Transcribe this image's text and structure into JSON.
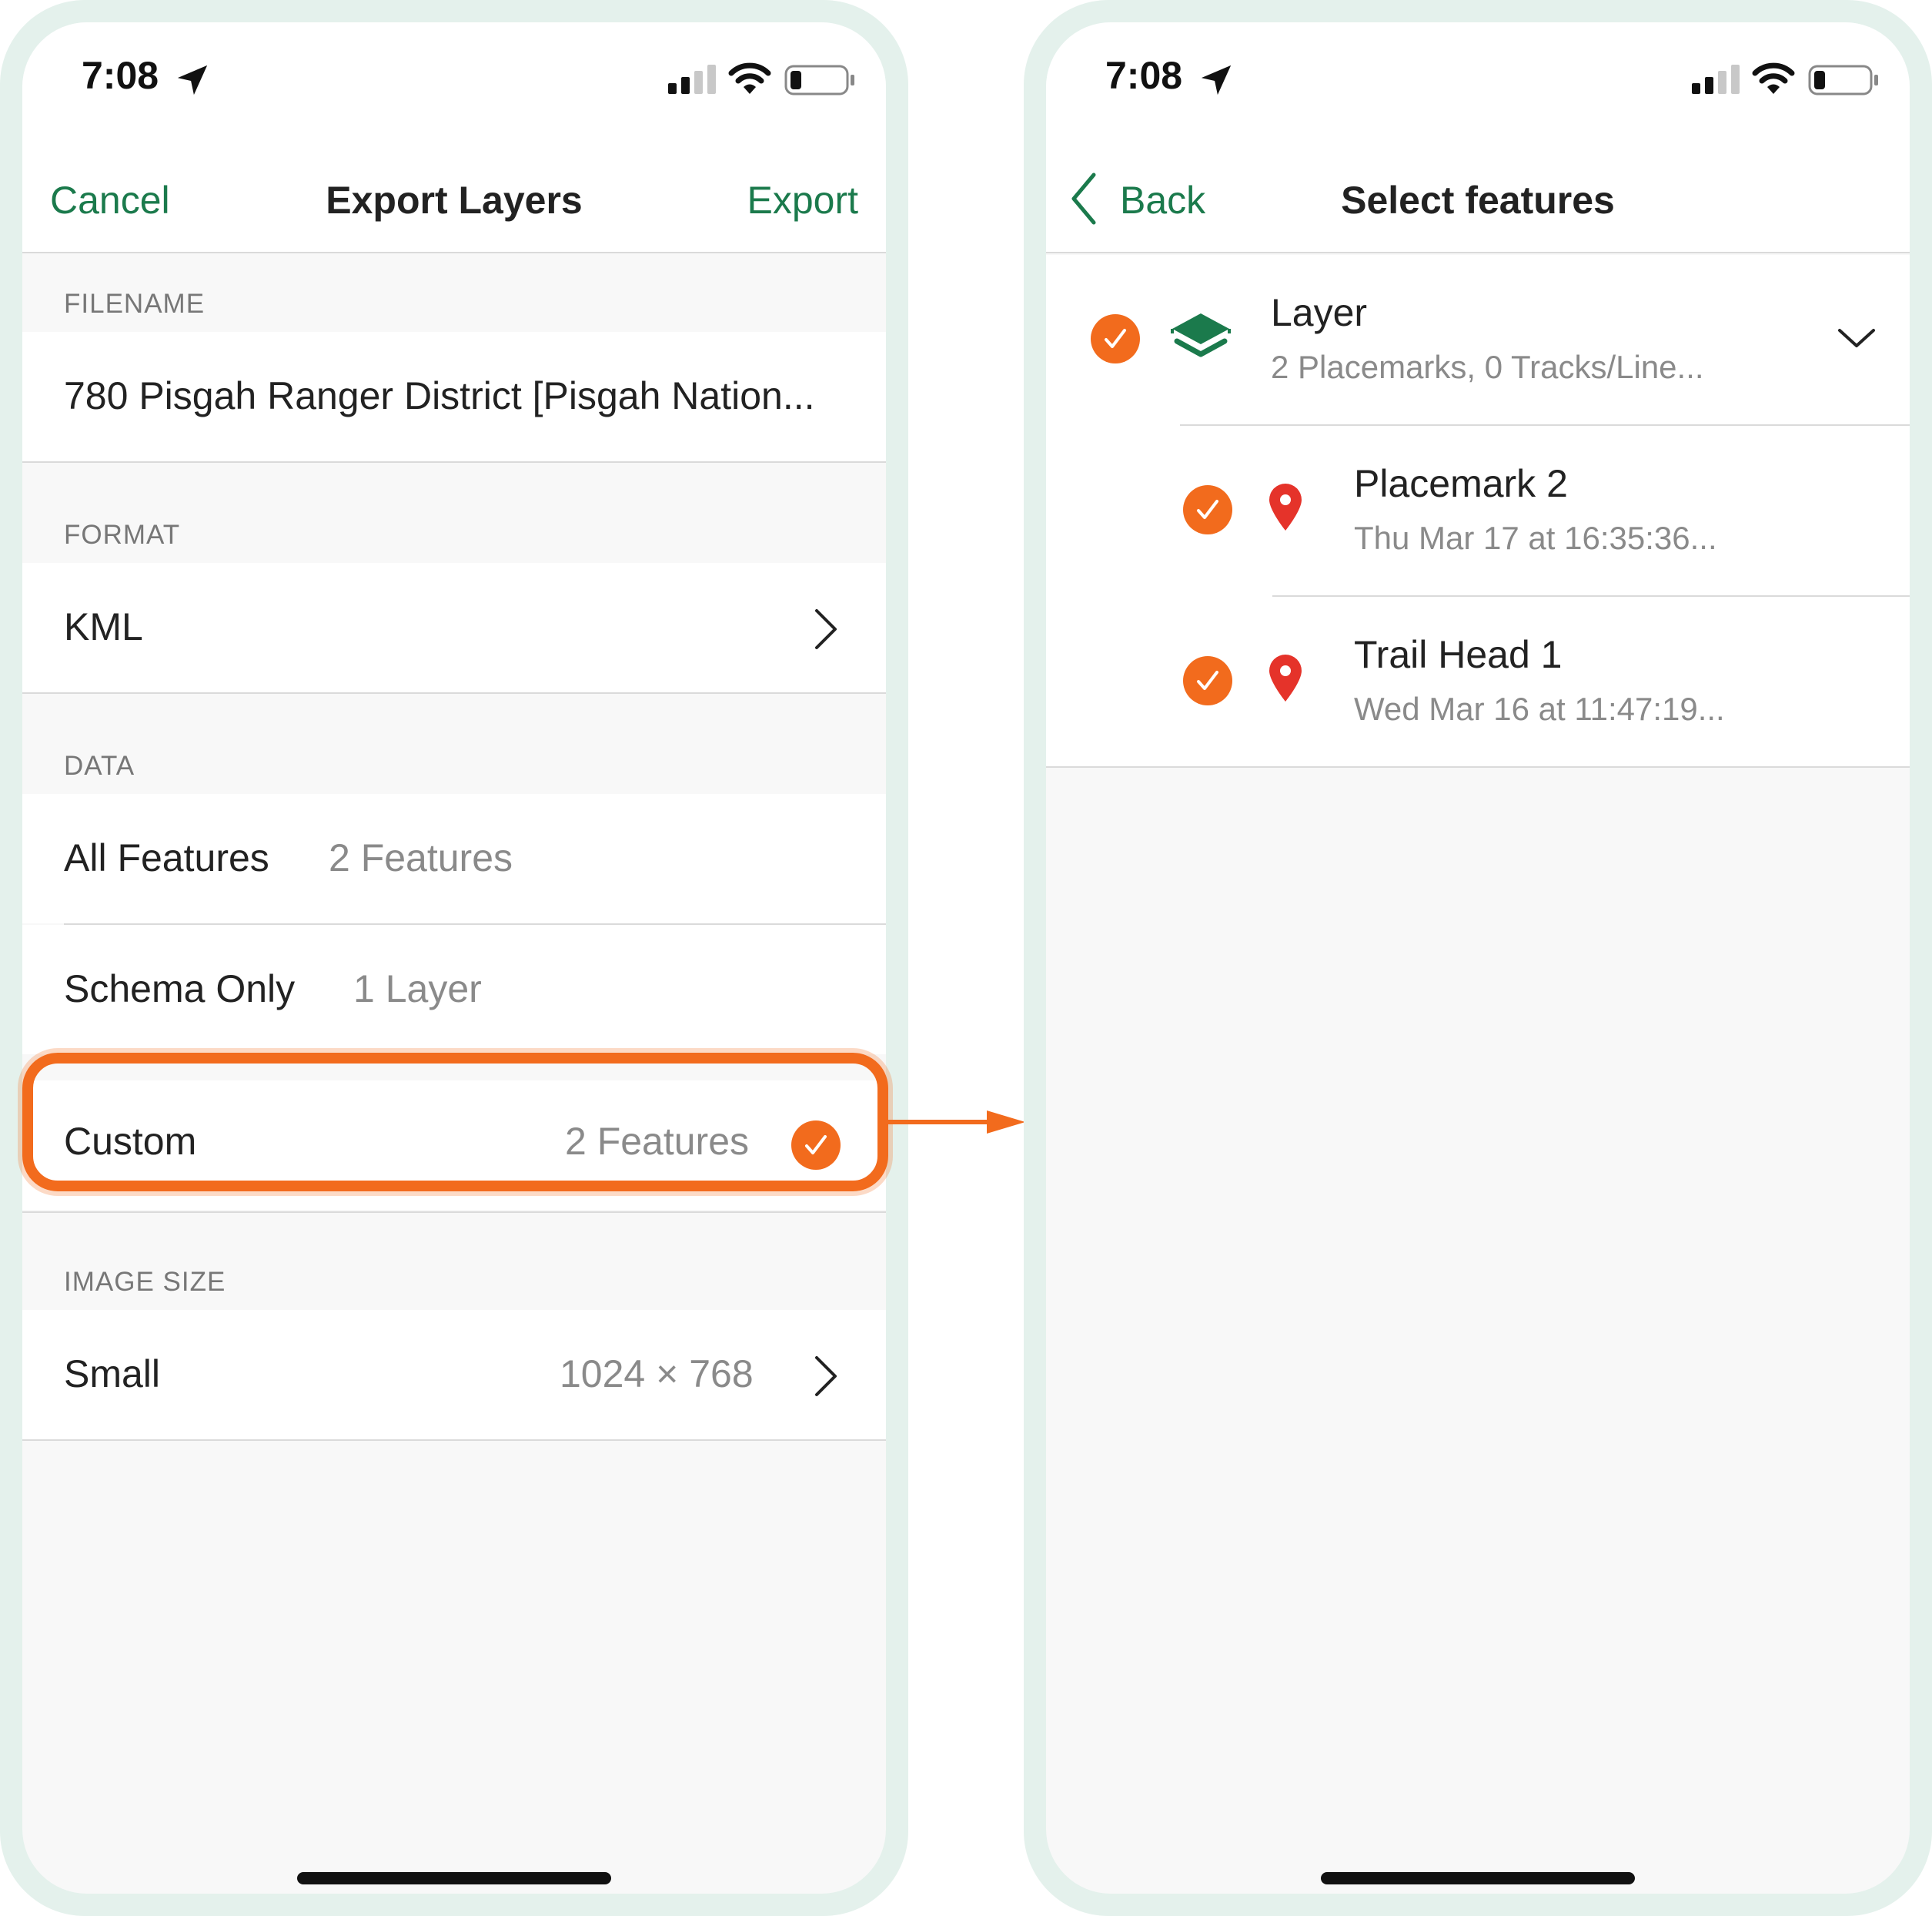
{
  "left_screen": {
    "status": {
      "time": "7:08"
    },
    "nav": {
      "cancel_label": "Cancel",
      "title": "Export Layers",
      "export_label": "Export"
    },
    "filename": {
      "header": "FILENAME",
      "value": "780 Pisgah Ranger District [Pisgah Nation..."
    },
    "format": {
      "header": "FORMAT",
      "value": "KML"
    },
    "data": {
      "header": "DATA",
      "options": [
        {
          "label": "All Features",
          "value": "2 Features",
          "selected": false
        },
        {
          "label": "Schema Only",
          "value": "1 Layer",
          "selected": false
        },
        {
          "label": "Custom",
          "value": "2 Features",
          "selected": true
        }
      ]
    },
    "image_size": {
      "header": "IMAGE SIZE",
      "label": "Small",
      "value": "1024 × 768"
    }
  },
  "right_screen": {
    "status": {
      "time": "7:08"
    },
    "nav": {
      "back_label": "Back",
      "title": "Select features"
    },
    "layer": {
      "name": "Layer",
      "summary": "2 Placemarks, 0 Tracks/Line...",
      "selected": true
    },
    "features": [
      {
        "name": "Placemark 2",
        "date": "Thu Mar 17 at 16:35:36...",
        "selected": true
      },
      {
        "name": "Trail Head 1",
        "date": "Wed Mar 16 at 11:47:19...",
        "selected": true
      }
    ]
  },
  "colors": {
    "accent_green": "#1b7a4c",
    "check_orange": "#f26b1d",
    "placemark_red": "#e5332a",
    "frame_mint": "#e4f1ec"
  },
  "icons": [
    "location-arrow-icon",
    "cellular-signal-icon",
    "wifi-icon",
    "battery-icon",
    "chevron-right-icon",
    "chevron-left-icon",
    "chevron-down-icon",
    "checkmark-circle-icon",
    "layers-icon",
    "placemark-pin-icon",
    "arrow-right-icon"
  ]
}
